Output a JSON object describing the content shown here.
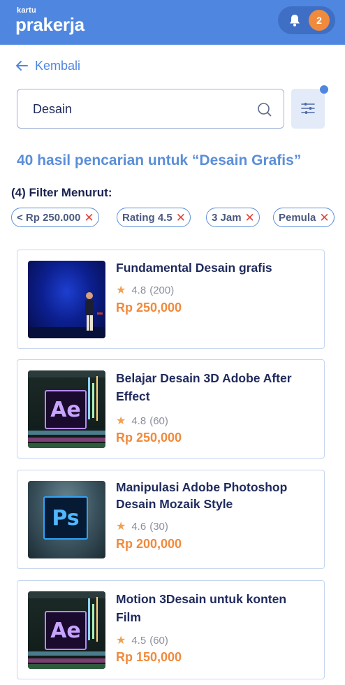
{
  "header": {
    "logo_small": "kartu",
    "logo_big": "prakerja",
    "notification_count": "2"
  },
  "nav": {
    "back_label": "Kembali"
  },
  "search": {
    "value": "Desain"
  },
  "results": {
    "title": "40 hasil pencarian untuk “Desain Grafis”",
    "filter_heading": "(4) Filter Menurut:"
  },
  "filters": [
    {
      "label": "< Rp 250.000"
    },
    {
      "label": "Rating 4.5"
    },
    {
      "label": "3 Jam"
    },
    {
      "label": "Pemula"
    }
  ],
  "courses": [
    {
      "title": "Fundamental Desain grafis",
      "rating": "4.8",
      "reviews": "(200)",
      "price": "Rp 250,000",
      "thumbnail": "speaker-on-stage"
    },
    {
      "title": "Belajar Desain 3D Adobe After Effect",
      "rating": "4.8",
      "reviews": "(60)",
      "price": "Rp 250,000",
      "thumbnail": "after-effects-logo",
      "logo_text": "Ae"
    },
    {
      "title": "Manipulasi Adobe Photoshop Desain Mozaik Style",
      "rating": "4.6",
      "reviews": "(30)",
      "price": "Rp 200,000",
      "thumbnail": "photoshop-logo",
      "logo_text": "Ps"
    },
    {
      "title": "Motion 3Desain untuk konten Film",
      "rating": "4.5",
      "reviews": "(60)",
      "price": "Rp 150,000",
      "thumbnail": "after-effects-logo",
      "logo_text": "Ae"
    }
  ],
  "colors": {
    "header": "#4f86e0",
    "accent": "#5b8ed9",
    "price": "#f08a3c",
    "remove": "#e0463f",
    "title": "#1f2a5c"
  }
}
